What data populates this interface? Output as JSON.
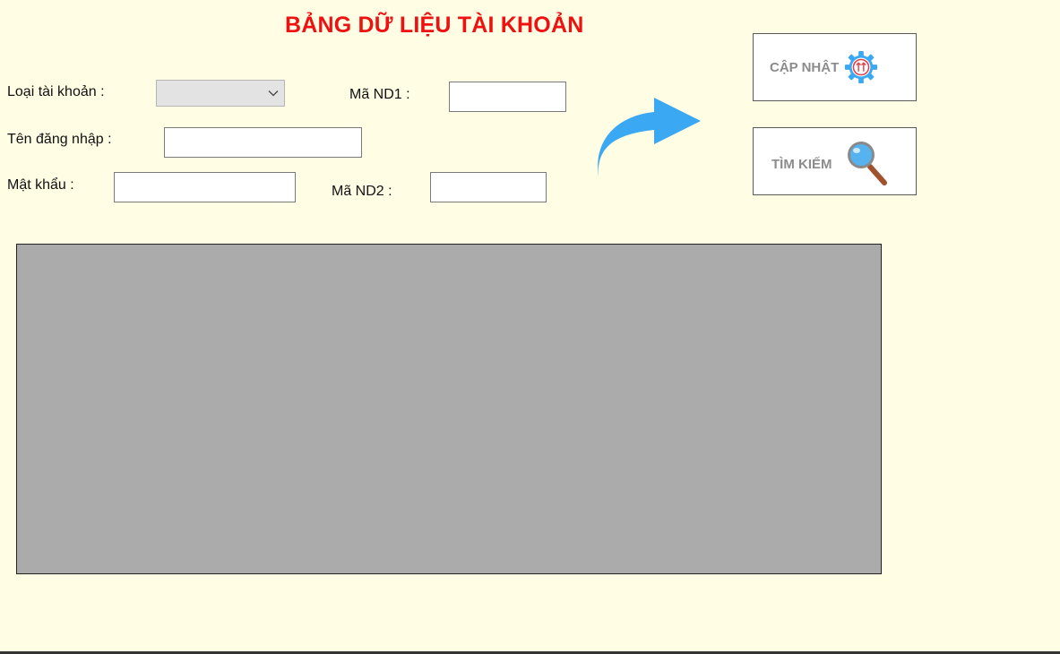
{
  "form": {
    "title": "BẢNG DỮ LIỆU TÀI KHOẢN",
    "account_type_label": "Loại tài khoản :",
    "account_type_value": "",
    "username_label": "Tên đăng nhập :",
    "username_value": "",
    "password_label": "Mật khẩu :",
    "password_value": "",
    "user_id1_label": "Mã ND1 :",
    "user_id1_value": "",
    "user_id2_label": "Mã ND2 :",
    "user_id2_value": ""
  },
  "actions": {
    "update_label": "CẬP NHẬT",
    "update_icon": "gear-update-icon",
    "search_label": "TÌM KIẾM",
    "search_icon": "magnifier-icon",
    "arrow_icon": "curved-arrow-right-icon"
  },
  "colors": {
    "background": "#fffde3",
    "title": "#ee1111",
    "grid": "#ababab",
    "arrow": "#3aa8f2"
  },
  "data_grid": {
    "rows": []
  }
}
